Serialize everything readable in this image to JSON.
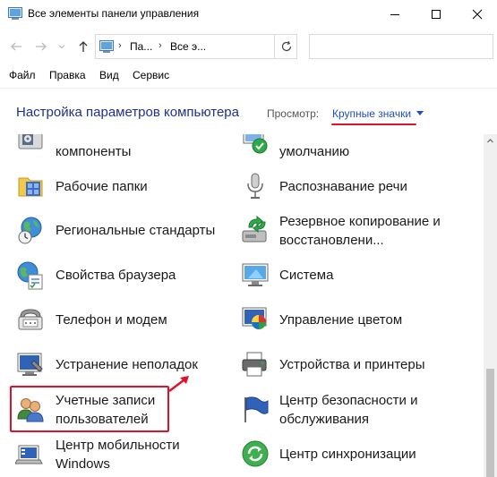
{
  "window": {
    "title": "Все элементы панели управления"
  },
  "address": {
    "crumbs": [
      "Па...",
      "Все э..."
    ],
    "separator": "›"
  },
  "menu": [
    "Файл",
    "Правка",
    "Вид",
    "Сервис"
  ],
  "header": {
    "title": "Настройка параметров компьютера",
    "view_label": "Просмотр:",
    "view_value": "Крупные значки"
  },
  "items_left": [
    {
      "line1": "компоненты",
      "icon": "programs-icon"
    },
    {
      "line1": "Рабочие папки",
      "icon": "work-folders-icon"
    },
    {
      "line1": "Региональные стандарты",
      "icon": "region-icon"
    },
    {
      "line1": "Свойства браузера",
      "icon": "internet-options-icon"
    },
    {
      "line1": "Телефон и модем",
      "icon": "phone-modem-icon"
    },
    {
      "line1": "Устранение неполадок",
      "icon": "troubleshooting-icon"
    },
    {
      "line1": "Учетные записи",
      "line2": "пользователей",
      "icon": "user-accounts-icon"
    },
    {
      "line1": "Центр мобильности",
      "line2": "Windows",
      "icon": "mobility-center-icon"
    }
  ],
  "items_right": [
    {
      "line1": "умолчанию",
      "icon": "default-programs-icon"
    },
    {
      "line1": "Распознавание речи",
      "icon": "speech-recognition-icon"
    },
    {
      "line1": "Резервное копирование и",
      "line2": "восстановлени...",
      "icon": "backup-restore-icon"
    },
    {
      "line1": "Система",
      "icon": "system-icon"
    },
    {
      "line1": "Управление цветом",
      "icon": "color-management-icon"
    },
    {
      "line1": "Устройства и принтеры",
      "icon": "devices-printers-icon"
    },
    {
      "line1": "Центр безопасности и",
      "line2": "обслуживания",
      "icon": "security-maintenance-icon"
    },
    {
      "line1": "Центр синхронизации",
      "icon": "sync-center-icon"
    }
  ],
  "colors": {
    "title_blue": "#1e3287",
    "link_blue": "#1e4fc1",
    "highlight_red": "#e0112b"
  }
}
